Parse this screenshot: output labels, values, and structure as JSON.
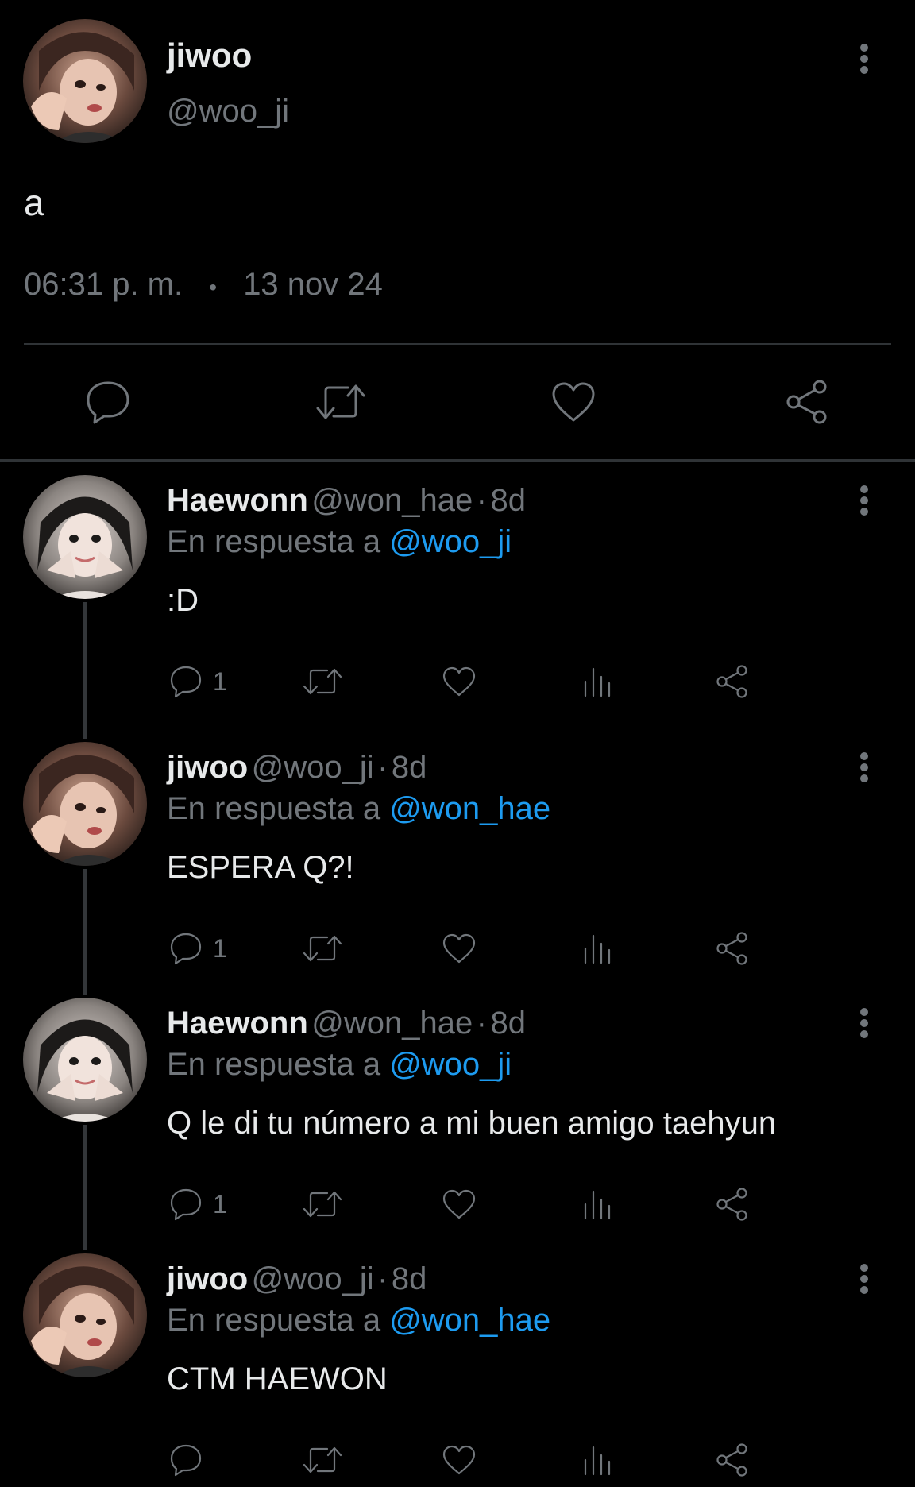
{
  "colors": {
    "accent": "#1d9bf0",
    "muted": "#71767b",
    "background": "#000000"
  },
  "main_tweet": {
    "display_name": "jiwoo",
    "handle": "@woo_ji",
    "text": "a",
    "time": "06:31 p. m.",
    "separator": "•",
    "date": "13 nov 24",
    "actions": [
      "reply-icon",
      "retweet-icon",
      "like-icon",
      "share-icon"
    ]
  },
  "replies": [
    {
      "display_name": "Haewonn",
      "handle": "@won_hae",
      "dot": "·",
      "age": "8d",
      "reply_prefix": "En respuesta a",
      "reply_to": "@woo_ji",
      "text": ":D",
      "reply_count": "1"
    },
    {
      "display_name": "jiwoo",
      "handle": "@woo_ji",
      "dot": "·",
      "age": "8d",
      "reply_prefix": "En respuesta a",
      "reply_to": "@won_hae",
      "text": "ESPERA Q?!",
      "reply_count": "1"
    },
    {
      "display_name": "Haewonn",
      "handle": "@won_hae",
      "dot": "·",
      "age": "8d",
      "reply_prefix": "En respuesta a",
      "reply_to": "@woo_ji",
      "text": "Q le di tu número a mi buen amigo taehyun",
      "reply_count": "1"
    },
    {
      "display_name": "jiwoo",
      "handle": "@woo_ji",
      "dot": "·",
      "age": "8d",
      "reply_prefix": "En respuesta a",
      "reply_to": "@won_hae",
      "text": "CTM HAEWON",
      "reply_count": ""
    }
  ]
}
